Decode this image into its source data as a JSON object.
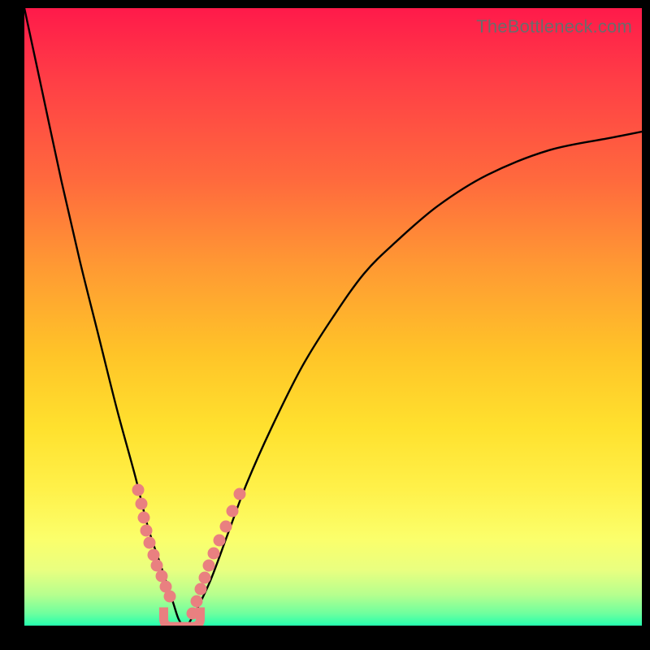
{
  "watermark": "TheBottleneck.com",
  "chart_data": {
    "type": "line",
    "title": "",
    "xlabel": "",
    "ylabel": "",
    "xlim": [
      0,
      100
    ],
    "ylim": [
      0,
      100
    ],
    "grid": false,
    "legend": false,
    "curve": {
      "name": "bottleneck-curve",
      "x": [
        0,
        3,
        6,
        9,
        12,
        15,
        18,
        20,
        22,
        24,
        25,
        26,
        27,
        30,
        33,
        36,
        40,
        45,
        50,
        55,
        60,
        67,
        75,
        85,
        95,
        100
      ],
      "y": [
        100,
        86,
        72,
        59,
        47,
        35,
        24,
        16,
        10,
        4,
        1,
        0,
        1,
        7,
        15,
        23,
        32,
        42,
        50,
        57,
        62,
        68,
        73,
        77,
        79,
        80
      ]
    },
    "scatter_left": {
      "name": "left-markers",
      "x": [
        18.4,
        18.9,
        19.3,
        19.8,
        20.3,
        20.9,
        21.5,
        22.2,
        22.9,
        23.6
      ],
      "y": [
        22.0,
        19.7,
        17.5,
        15.4,
        13.4,
        11.5,
        9.7,
        8.0,
        6.3,
        4.8
      ]
    },
    "scatter_right": {
      "name": "right-markers",
      "x": [
        27.2,
        27.9,
        28.5,
        29.2,
        29.9,
        30.7,
        31.6,
        32.6,
        33.7,
        34.9
      ],
      "y": [
        2.0,
        4.0,
        5.9,
        7.8,
        9.7,
        11.7,
        13.8,
        16.1,
        18.6,
        21.3
      ]
    },
    "valley_marker": {
      "x": 25.5,
      "y": 0.3
    }
  }
}
